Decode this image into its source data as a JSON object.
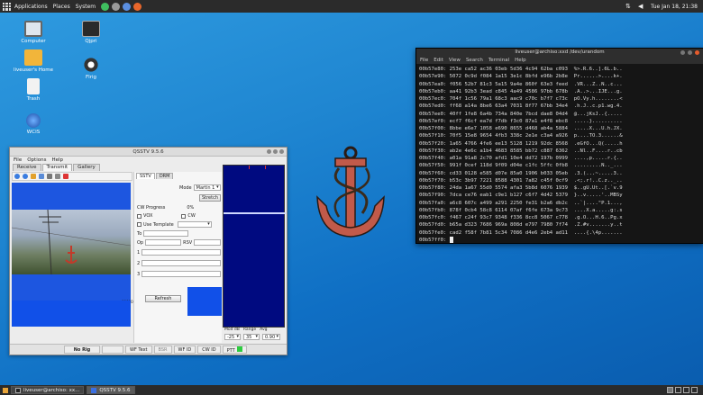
{
  "top_panel": {
    "menu": [
      "Applications",
      "Places",
      "System"
    ],
    "clock": "Tue Jan 18, 21:38"
  },
  "desktop_icons": [
    {
      "label": "Computer"
    },
    {
      "label": "liveuser's Home"
    },
    {
      "label": "Trash"
    },
    {
      "label": "WCIS"
    },
    {
      "label": "Qjpri"
    },
    {
      "label": "Flrig"
    }
  ],
  "qsstv": {
    "title": "QSSTV 9.5.6",
    "menu": [
      "File",
      "Options",
      "Help"
    ],
    "tabs": [
      "Receive",
      "Transmit",
      "Gallery"
    ],
    "active_tab": 1,
    "sub_tabs": [
      "SSTV",
      "DRM"
    ],
    "mode_label": "Mode",
    "mode_value": "Martin 1",
    "stretch_button": "Stretch",
    "cw_progress_label": "CW Progress",
    "cw_progress_value": "0%",
    "vox_label": "VOX",
    "cw_label": "CW",
    "use_template_label": "Use Template",
    "to_label": "To",
    "op_label": "Op",
    "rsv_label": "RSV",
    "field_1_label": "1",
    "field_2_label": "2",
    "field_3_label": "3",
    "refresh_button": "Refresh",
    "progress_left": "0",
    "progress_mid": "000000",
    "transmit_progress": 0.45,
    "meter": {
      "mod_label": "Mod dB",
      "range_label": "Range",
      "avg_label": "Avg",
      "mod_value": "-25",
      "range_value": "35",
      "avg_value": "0.90"
    },
    "status": {
      "rig": "No Rig",
      "wf_text": "WF Text",
      "bsr": "BSR",
      "wf_id": "WF ID",
      "cw_id": "CW ID",
      "ptt": "PTT"
    }
  },
  "terminal": {
    "title": "liveuser@archiso:xxd /dev/urandom",
    "menu": [
      "File",
      "Edit",
      "View",
      "Search",
      "Terminal",
      "Help"
    ],
    "lines": [
      "00b57e80: 253e ca52 ac36 03eb 5d36 4c94 62ba c093  %>.R.6..].6L.b..",
      "00b57e90: 5072 0c9d f084 1a15 3e1c 8bfd e96b 2b8e  Pr......>....k+.",
      "00b57ea0: f056 52b7 81c3 5a15 9a4e 860f 63e3 feed  .VR...Z..N..c...",
      "00b57eb0: aa41 92b3 3ead c845 4a49 4586 97bb 678b  .A..>...IJE...g.",
      "00b57ec0: 704f 1c56 79a1 68c3 aac9 c70c b7f7 c73c  pO.Vy.h........<",
      "00b57ed0: ff68 a14a 8be6 63a4 7031 8f77 67bb 34e4  .h.J..c.p1.wg.4.",
      "00b57ee0: 40ff 1fe8 6a4b 734a 840e 7bcd dae8 04d4  @...jKsJ..{.....",
      "00b57ef0: ecf7 f6cf ea7d f7db f3c0 87a1 e4f8 ebc8  .....}..........",
      "00b57f00: 8bbe e6e7 1058 e690 8655 d468 ab4a 5884  .....X...U.h.JX.",
      "00b57f10: 70f5 15e8 9654 4fb3 338c 2e1e c3a4 a926  p....TO.3......&",
      "00b57f20: 1a65 4766 4fe6 ee13 5128 1219 92dc 8568  .eGfO...Q(.....h",
      "00b57f30: ab2e 4e6c a1b4 4683 8585 bb72 c887 6362  ..Nl..F....r..cb",
      "00b57f40: a01a 91a8 2c70 afd1 10e4 dd72 197b 0999  ....,p.....r.{..",
      "00b57f50: 991f 0cef 118d 9f09 d04e c1fc 5ffc 0fb8  .........N.._...",
      "00b57f60: cd33 0128 e585 d07e 85a0 1906 b033 05eb  .3.(...~.....3..",
      "00b57f70: b53c 3b97 7221 8588 4301 7a82 c45f 0cf9  .<;.r!..C.z.._..",
      "00b57f80: 24da 1a67 55d0 5574 afa3 5b8d 6076 1939  $..gU.Ut..[.`v.9",
      "00b57f90: 7dca ce76 eab1 c9e1 b127 c6f7 4d42 5379  }..v.....'..MBSy",
      "00b57fa0: a6c8 607c a499 a291 2250 fe31 b2a6 db2c  ..`|....\"P.1...,",
      "00b57fb0: 878f 0cb4 58c8 6114 07af f6fe 673a 9c73  ....X.a.....g:.s",
      "00b57fc0: f467 c24f 93c7 9348 f336 8cc8 5067 c778  .g.O...H.6..Pg.x",
      "00b57fd0: b65a d323 7686 969a 808d e797 7980 7f74  .Z.#v.......y..t",
      "00b57fe0: cad2 f58f 7b81 5c34 7086 d4e6 2eb4 ad11  ....{.\\4p.......",
      "00b57ff0: "
    ]
  },
  "taskbar": {
    "items": [
      "liveuser@archiso: xx...",
      "QSSTV 9.5.6"
    ]
  },
  "colors": {
    "desktop": "#1f86d1",
    "panel": "#2b2b2b",
    "accent_blue": "#1150e8",
    "waterfall": "#000a80"
  }
}
